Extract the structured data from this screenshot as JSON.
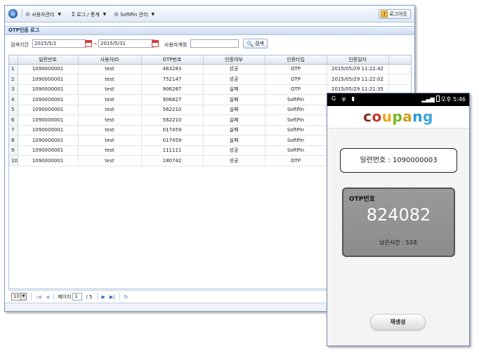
{
  "menubar": {
    "menus": [
      {
        "label": "사용자관리",
        "icon": "users-icon"
      },
      {
        "label": "로그 / 통계",
        "icon": "sigma-icon"
      },
      {
        "label": "SoftPin 관리",
        "icon": "gear-icon"
      }
    ],
    "sigma_glyph": "Σ",
    "logout_label": "로그아웃"
  },
  "panel": {
    "title": "OTP인증 로그"
  },
  "search": {
    "period_label": "검색기간",
    "date_from": "2015/5/1",
    "tilde": "~",
    "date_to": "2015/5/31",
    "account_label": "사용자계정",
    "account_value": "",
    "search_button": "검색"
  },
  "table": {
    "columns": [
      "일련번호",
      "사용자ID",
      "OTP번호",
      "인증여부",
      "인증타입",
      "인증일자"
    ],
    "rows": [
      [
        "1",
        "1090000001",
        "test",
        "463283",
        "성공",
        "OTP",
        "2015/05/29 11:22:42"
      ],
      [
        "2",
        "1090000001",
        "test",
        "752147",
        "성공",
        "OTP",
        "2015/05/29 11:22:02"
      ],
      [
        "3",
        "1090000001",
        "test",
        "906287",
        "실패",
        "OTP",
        "2015/05/29 11:21:35"
      ],
      [
        "4",
        "1090000001",
        "test",
        "906827",
        "실패",
        "SoftPin",
        ""
      ],
      [
        "5",
        "1090000001",
        "test",
        "562210",
        "실패",
        "SoftPin",
        ""
      ],
      [
        "6",
        "1090000001",
        "test",
        "562210",
        "실패",
        "SoftPin",
        ""
      ],
      [
        "7",
        "1090000001",
        "test",
        "017459",
        "실패",
        "SoftPin",
        ""
      ],
      [
        "8",
        "1090000001",
        "test",
        "017459",
        "실패",
        "SoftPin",
        ""
      ],
      [
        "9",
        "1090000001",
        "test",
        "111111",
        "성공",
        "SoftPin",
        ""
      ],
      [
        "10",
        "1090000001",
        "test",
        "180742",
        "성공",
        "OTP",
        ""
      ]
    ]
  },
  "pager": {
    "page_size": "10",
    "page_label": "페이지",
    "current_page": "1",
    "total_pages": "/ 5"
  },
  "phone": {
    "status_left": "G ψ ▮",
    "status_right": "오후 5:46",
    "logo_letters": [
      "c",
      "o",
      "u",
      "p",
      "a",
      "n",
      "g"
    ],
    "logo_colors": [
      "#8b2b1b",
      "#c0392b",
      "#f2a51a",
      "#7ab51d",
      "#c9a11e",
      "#1f9bd7",
      "#3aa7d8"
    ],
    "serial_text": "일련번호 : 1090000003",
    "otp_label": "OTP번호",
    "otp_code": "824082",
    "remaining_text": "남은시간 : 53초",
    "regen_button": "재생성"
  }
}
